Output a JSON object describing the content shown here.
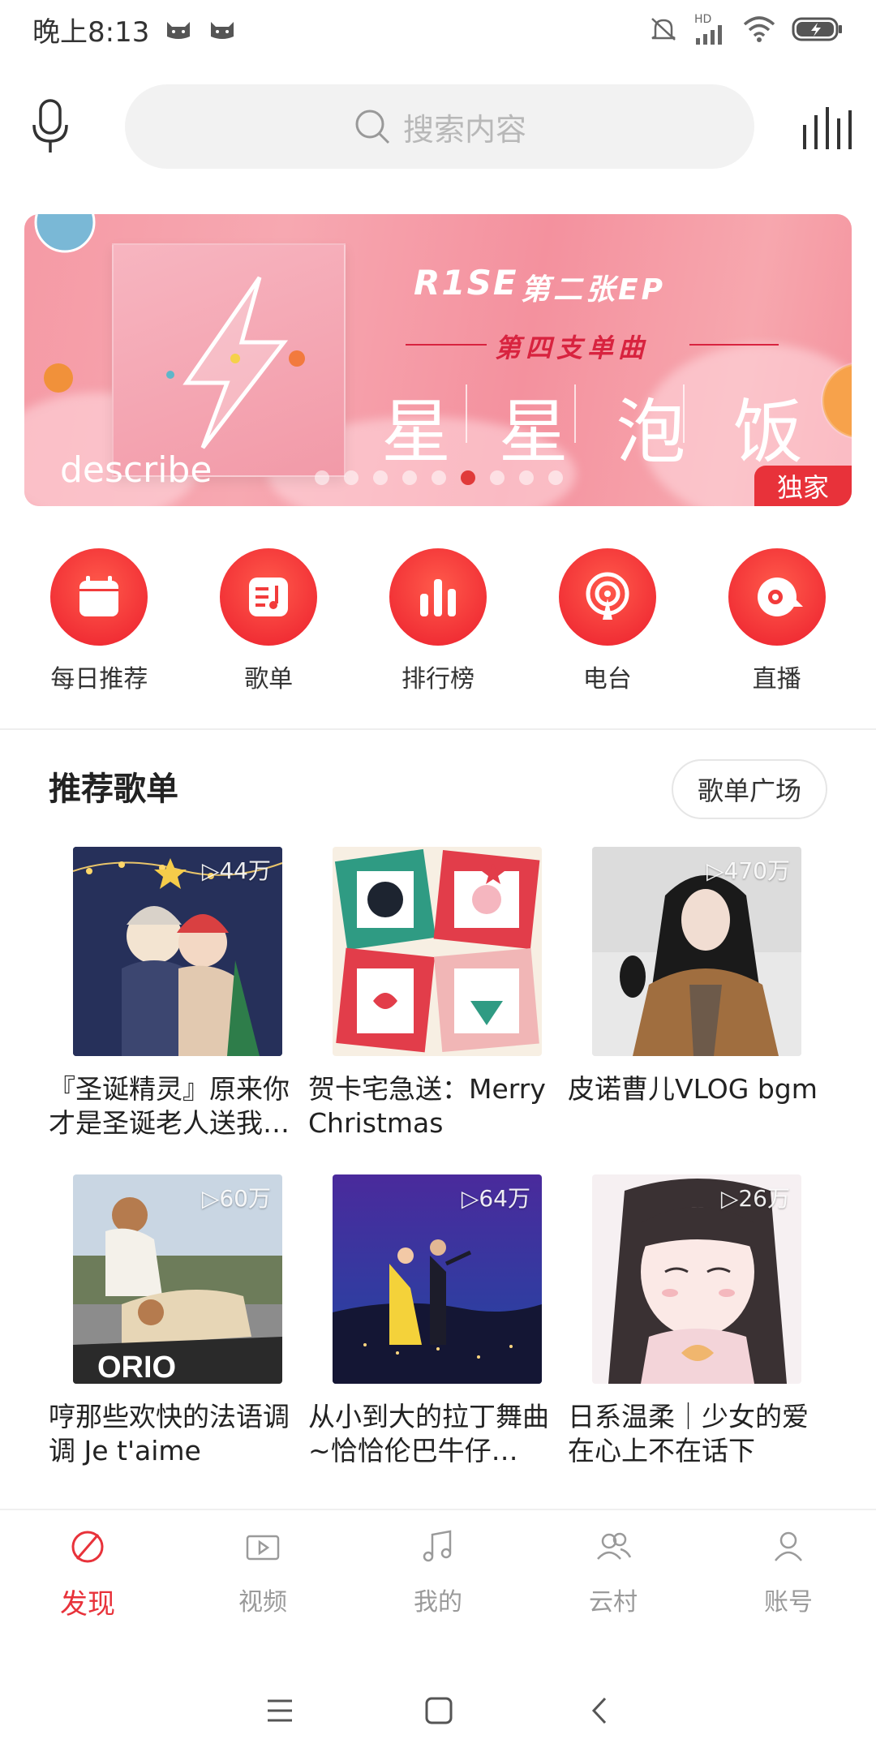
{
  "status": {
    "time": "晚上8:13",
    "network": "HD"
  },
  "search": {
    "placeholder": "搜索内容"
  },
  "banner": {
    "brand": "R1SE",
    "ep_text": "第二张EP",
    "single_text": "第四支单曲",
    "song_chars": [
      "星",
      "星",
      "泡",
      "饭"
    ],
    "describe": "describe",
    "badge": "独家",
    "dot_count": 9,
    "active_dot": 5
  },
  "quick_entries": [
    {
      "label": "每日推荐",
      "icon": "calendar-icon"
    },
    {
      "label": "歌单",
      "icon": "playlist-icon"
    },
    {
      "label": "排行榜",
      "icon": "chart-bars-icon"
    },
    {
      "label": "电台",
      "icon": "radio-icon"
    },
    {
      "label": "直播",
      "icon": "live-icon"
    }
  ],
  "recommend": {
    "title": "推荐歌单",
    "more": "歌单广场",
    "playlists": [
      {
        "title": "『圣诞精灵』原来你才是圣诞老人送我…",
        "plays": "▷44万"
      },
      {
        "title": "贺卡宅急送：Merry Christmas",
        "plays": ""
      },
      {
        "title": "皮诺曹儿VLOG bgm",
        "plays": "▷470万"
      },
      {
        "title": "哼那些欢快的法语调调 Je t'aime",
        "plays": "▷60万"
      },
      {
        "title": "从小到大的拉丁舞曲~恰恰伦巴牛仔…",
        "plays": "▷64万"
      },
      {
        "title": "日系温柔｜少女的爱在心上不在话下",
        "plays": "▷26万"
      }
    ]
  },
  "tabs": [
    {
      "label": "发现",
      "icon": "discover-icon",
      "active": true
    },
    {
      "label": "视频",
      "icon": "video-icon",
      "active": false
    },
    {
      "label": "我的",
      "icon": "music-note-icon",
      "active": false
    },
    {
      "label": "云村",
      "icon": "community-icon",
      "active": false
    },
    {
      "label": "账号",
      "icon": "account-icon",
      "active": false
    }
  ],
  "colors": {
    "accent": "#e8323a",
    "banner_pink": "#f59aa5"
  }
}
